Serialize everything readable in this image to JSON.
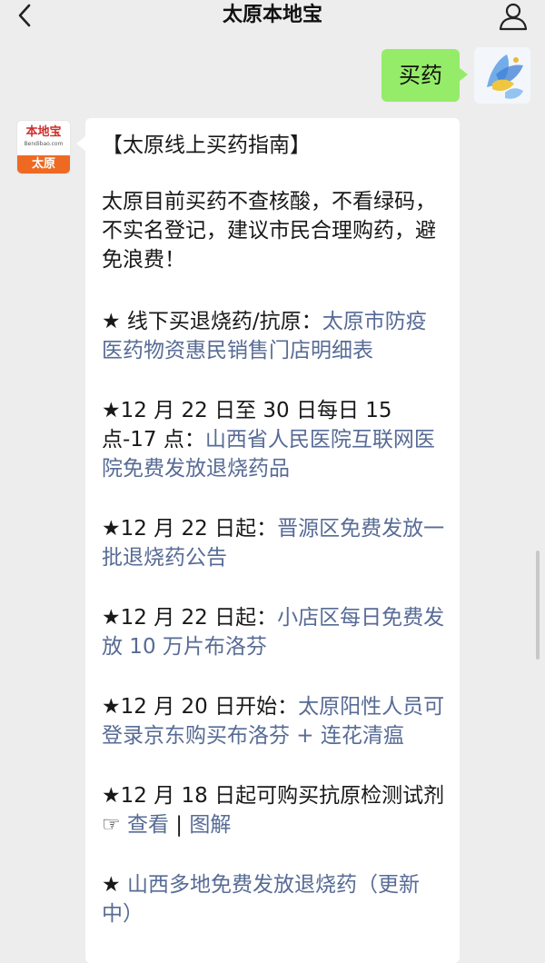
{
  "header": {
    "title": "太原本地宝"
  },
  "outgoing": {
    "text": "买药"
  },
  "bot": {
    "logo_name": "本地宝",
    "logo_url": "Bendibao.com",
    "logo_city": "太原"
  },
  "message": {
    "title": "【太原线上买药指南】",
    "intro": "太原目前买药不查核酸，不看绿码，不实名登记，建议市民合理购药，避免浪费！",
    "item1_prefix": "★ 线下买退烧药/抗原：",
    "item1_link": "太原市防疫医药物资惠民销售门店明细表",
    "item2_prefix": "★12 月 22 日至 30 日每日 15 点-17 点：",
    "item2_link": "山西省人民医院互联网医院免费发放退烧药品",
    "item3_prefix": "★12 月 22 日起：",
    "item3_link": "晋源区免费发放一批退烧药公告",
    "item4_prefix": "★12 月 22 日起：",
    "item4_link": "小店区每日免费发放 10 万片布洛芬",
    "item5_prefix": "★12 月 20 日开始：",
    "item5_link": "太原阳性人员可登录京东购买布洛芬 + 连花清瘟",
    "item6_prefix": "★12 月 18 日起可购买抗原检测试剂 ☞ ",
    "item6_link_a": "查看",
    "item6_sep": " | ",
    "item6_link_b": "图解",
    "item7_prefix": "★ ",
    "item7_link": "山西多地免费发放退烧药（更新中）"
  }
}
